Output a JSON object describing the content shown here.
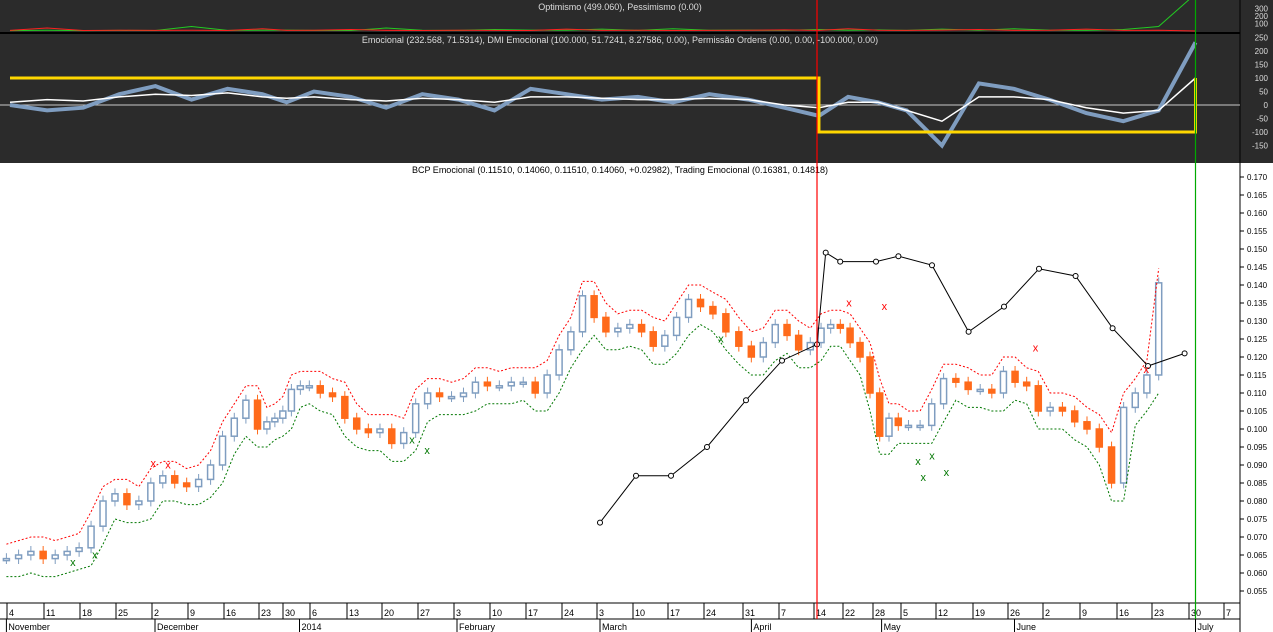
{
  "panels": {
    "optimism_title": "Optimismo (499.060), Pessimismo (0.00)",
    "emotional_title": "Emocional (232.568, 71.5314), DMI Emocional (100.000, 51.7241, 8.27586, 0.00), Permissão Ordens (0.00, 0.00, -100.000, 0.00)",
    "price_title": "BCP Emocional (0.11510, 0.14060, 0.11510, 0.14060, +0.02982), Trading Emocional (0.16381, 0.14818)"
  },
  "chart_data": [
    {
      "type": "line",
      "title": "Optimismo (499.060), Pessimismo (0.00)",
      "yticks": [
        "300",
        "200",
        "100"
      ],
      "ylim": [
        0,
        350
      ],
      "series": [
        {
          "name": "Optimismo",
          "color": "#22cc22",
          "values": [
            5,
            10,
            5,
            8,
            6,
            60,
            8,
            10,
            12,
            8,
            6,
            40,
            10,
            8,
            20,
            12,
            10,
            25,
            8,
            30,
            10,
            12,
            8,
            20,
            10,
            15,
            8,
            25,
            10,
            30,
            12,
            8,
            20,
            60,
            499
          ]
        },
        {
          "name": "Pessimismo",
          "color": "#ff2020",
          "values": [
            8,
            40,
            6,
            10,
            8,
            10,
            6,
            30,
            8,
            10,
            20,
            8,
            6,
            10,
            8,
            6,
            25,
            8,
            10,
            6,
            8,
            10,
            15,
            8,
            30,
            10,
            8,
            12,
            20,
            8,
            10,
            25,
            8,
            10,
            0
          ]
        }
      ]
    },
    {
      "type": "line",
      "title": "Emocional",
      "yticks": [
        "250",
        "200",
        "150",
        "100",
        "50",
        "0",
        "-50",
        "-100",
        "-150"
      ],
      "ylim": [
        -180,
        270
      ],
      "series": [
        {
          "name": "Emocional",
          "color": "#7f9dc0",
          "values": [
            0,
            -20,
            -10,
            40,
            70,
            20,
            60,
            40,
            10,
            50,
            30,
            -10,
            40,
            20,
            -20,
            60,
            40,
            20,
            30,
            10,
            40,
            20,
            -10,
            -40,
            30,
            10,
            -20,
            -150,
            80,
            60,
            20,
            -30,
            -60,
            -20,
            232
          ]
        },
        {
          "name": "DMI",
          "color": "#ffffff",
          "values": [
            10,
            20,
            15,
            30,
            40,
            35,
            45,
            30,
            25,
            30,
            20,
            15,
            25,
            20,
            10,
            30,
            30,
            25,
            20,
            20,
            25,
            20,
            0,
            -10,
            10,
            10,
            -20,
            -60,
            30,
            30,
            20,
            -10,
            -30,
            -20,
            100
          ]
        },
        {
          "name": "Permissao Ordens",
          "color": "#ffd700",
          "values": [
            100,
            100,
            100,
            100,
            100,
            100,
            100,
            100,
            100,
            100,
            100,
            100,
            100,
            100,
            100,
            100,
            100,
            100,
            100,
            100,
            100,
            100,
            100,
            -100,
            -100,
            -100,
            -100,
            -100,
            -100,
            -100,
            -100,
            -100,
            -100,
            -100,
            100
          ]
        }
      ]
    },
    {
      "type": "candlestick",
      "title": "BCP Emocional",
      "ylim": [
        0.052,
        0.172
      ],
      "yticks": [
        "0.170",
        "0.165",
        "0.160",
        "0.155",
        "0.150",
        "0.145",
        "0.140",
        "0.135",
        "0.130",
        "0.125",
        "0.120",
        "0.115",
        "0.110",
        "0.105",
        "0.100",
        "0.095",
        "0.090",
        "0.085",
        "0.080",
        "0.075",
        "0.070",
        "0.065",
        "0.060",
        "0.055"
      ],
      "xticks": [
        "4",
        "11",
        "18",
        "25",
        "2",
        "9",
        "16",
        "23",
        "30",
        "6",
        "13",
        "20",
        "27",
        "3",
        "10",
        "17",
        "24",
        "3",
        "10",
        "17",
        "24",
        "31",
        "7",
        "14",
        "22",
        "28",
        "5",
        "12",
        "19",
        "26",
        "2",
        "9",
        "16",
        "23",
        "30",
        "7"
      ],
      "months": [
        {
          "label": "November",
          "week": -0.1
        },
        {
          "label": "December",
          "week": 4
        },
        {
          "label": "2014",
          "week": 8.5
        },
        {
          "label": "February",
          "week": 13
        },
        {
          "label": "March",
          "week": 17
        },
        {
          "label": "April",
          "week": 21.15
        },
        {
          "label": "May",
          "week": 25.2
        },
        {
          "label": "June",
          "week": 29.1
        },
        {
          "label": "July",
          "week": 34.1
        }
      ],
      "close": [
        0.064,
        0.065,
        0.066,
        0.064,
        0.065,
        0.066,
        0.067,
        0.073,
        0.08,
        0.082,
        0.079,
        0.08,
        0.085,
        0.087,
        0.085,
        0.084,
        0.086,
        0.09,
        0.098,
        0.103,
        0.108,
        0.1,
        0.102,
        0.103,
        0.105,
        0.111,
        0.112,
        0.112,
        0.11,
        0.109,
        0.103,
        0.1,
        0.099,
        0.1,
        0.096,
        0.099,
        0.107,
        0.11,
        0.109,
        0.109,
        0.11,
        0.113,
        0.112,
        0.112,
        0.113,
        0.113,
        0.11,
        0.115,
        0.122,
        0.127,
        0.137,
        0.131,
        0.127,
        0.128,
        0.129,
        0.127,
        0.123,
        0.126,
        0.131,
        0.136,
        0.134,
        0.132,
        0.127,
        0.123,
        0.12,
        0.124,
        0.129,
        0.126,
        0.122,
        0.124,
        0.128,
        0.129,
        0.128,
        0.124,
        0.12,
        0.11,
        0.098,
        0.103,
        0.101,
        0.101,
        0.101,
        0.107,
        0.114,
        0.113,
        0.111,
        0.111,
        0.11,
        0.116,
        0.113,
        0.112,
        0.105,
        0.106,
        0.105,
        0.102,
        0.1,
        0.095,
        0.085,
        0.106,
        0.11,
        0.115,
        0.1406
      ],
      "close_week_range": [
        -0.1,
        33.1
      ],
      "trading_emocional": [
        [
          17,
          0.074
        ],
        [
          18,
          0.087
        ],
        [
          19,
          0.087
        ],
        [
          20,
          0.095
        ],
        [
          21,
          0.108
        ],
        [
          22,
          0.119
        ],
        [
          23,
          0.1235
        ],
        [
          23.3,
          0.149
        ],
        [
          23.8,
          0.1465
        ],
        [
          25,
          0.1465
        ],
        [
          25.8,
          0.148
        ],
        [
          26.8,
          0.1455
        ],
        [
          27.8,
          0.127
        ],
        [
          28.8,
          0.134
        ],
        [
          29.8,
          0.1445
        ],
        [
          30.8,
          0.1425
        ],
        [
          31.8,
          0.128
        ],
        [
          32.8,
          0.1175
        ],
        [
          33.8,
          0.121
        ]
      ],
      "sell_signals": [
        [
          3.95,
          0.0895
        ],
        [
          4.36,
          0.089
        ],
        [
          24.1,
          0.134
        ],
        [
          25.3,
          0.133
        ],
        [
          29.7,
          0.1215
        ],
        [
          32.75,
          0.1155
        ]
      ],
      "buy_signals": [
        [
          1.72,
          0.062
        ],
        [
          2.33,
          0.064
        ],
        [
          11.75,
          0.096
        ],
        [
          12.17,
          0.093
        ],
        [
          20.36,
          0.124
        ],
        [
          26.4,
          0.09
        ],
        [
          26.55,
          0.0855
        ],
        [
          26.8,
          0.0915
        ],
        [
          27.2,
          0.087
        ]
      ],
      "markers": [
        {
          "week": 23,
          "color": "#ff0000"
        },
        {
          "week": 34.1,
          "color": "#00aa00"
        }
      ],
      "colors": {
        "up": "#7f9dc0",
        "down": "#ff6a1a",
        "upper_band": "#ff0000",
        "lower_band": "#007700"
      }
    }
  ]
}
